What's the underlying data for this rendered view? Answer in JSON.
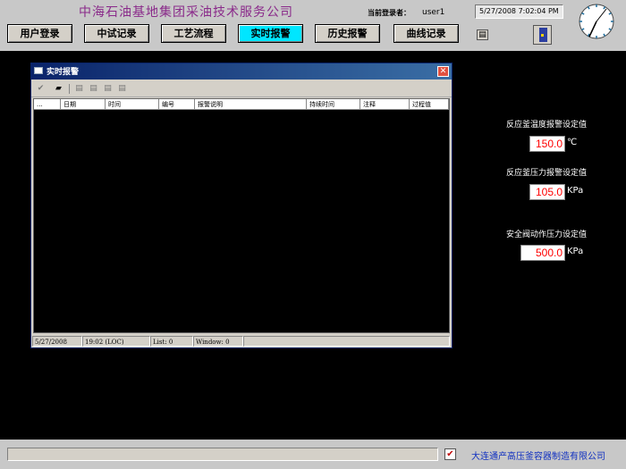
{
  "header": {
    "company": "中海石油基地集团采油技术服务公司",
    "user_caption": "当前登录者：",
    "user_name": "user1",
    "datetime": "5/27/2008 7:02:04 PM",
    "nav": [
      {
        "label": "用户登录",
        "active": false
      },
      {
        "label": "中试记录",
        "active": false
      },
      {
        "label": "工艺流程",
        "active": false
      },
      {
        "label": "实时报警",
        "active": true
      },
      {
        "label": "历史报警",
        "active": false
      },
      {
        "label": "曲线记录",
        "active": false
      }
    ],
    "print_icon": "printer-icon",
    "exit_icon": "exit-door-icon"
  },
  "alarm_window": {
    "title": "实时报警",
    "close_glyph": "✕",
    "toolbar": [
      {
        "icon": "acknowledge-icon",
        "glyph": "✔",
        "enabled": false
      },
      {
        "icon": "print-icon",
        "glyph": "▰",
        "enabled": true
      },
      {
        "icon": "first-icon",
        "glyph": "▤",
        "enabled": false
      },
      {
        "icon": "prev-icon",
        "glyph": "▤",
        "enabled": false
      },
      {
        "icon": "next-icon",
        "glyph": "▤",
        "enabled": false
      },
      {
        "icon": "last-icon",
        "glyph": "▤",
        "enabled": false
      }
    ],
    "columns": [
      "...",
      "日期",
      "时间",
      "编号",
      "报警说明",
      "持续时间",
      "注释",
      "过程值"
    ],
    "rows": [],
    "status": {
      "date": "5/27/2008",
      "time": "19:02 (LOC)",
      "list": "List: 0",
      "window": "Window: 0"
    }
  },
  "setpoints": [
    {
      "label": "反应釜温度报警设定值",
      "value": "150.0",
      "unit": "℃"
    },
    {
      "label": "反应釜压力报警设定值",
      "value": "105.0",
      "unit": "KPa"
    },
    {
      "label": "安全阀动作压力设定值",
      "value": "500.0",
      "unit": "KPa"
    }
  ],
  "footer": {
    "check_glyph": "✔",
    "manufacturer": "大连通产高压釜容器制造有限公司"
  },
  "colors": {
    "nav_active": "#00e6ff",
    "company_text": "#8a2a8a",
    "setpoint_value": "#ff0000",
    "manufacturer_text": "#1030c0",
    "background": "#000000"
  }
}
